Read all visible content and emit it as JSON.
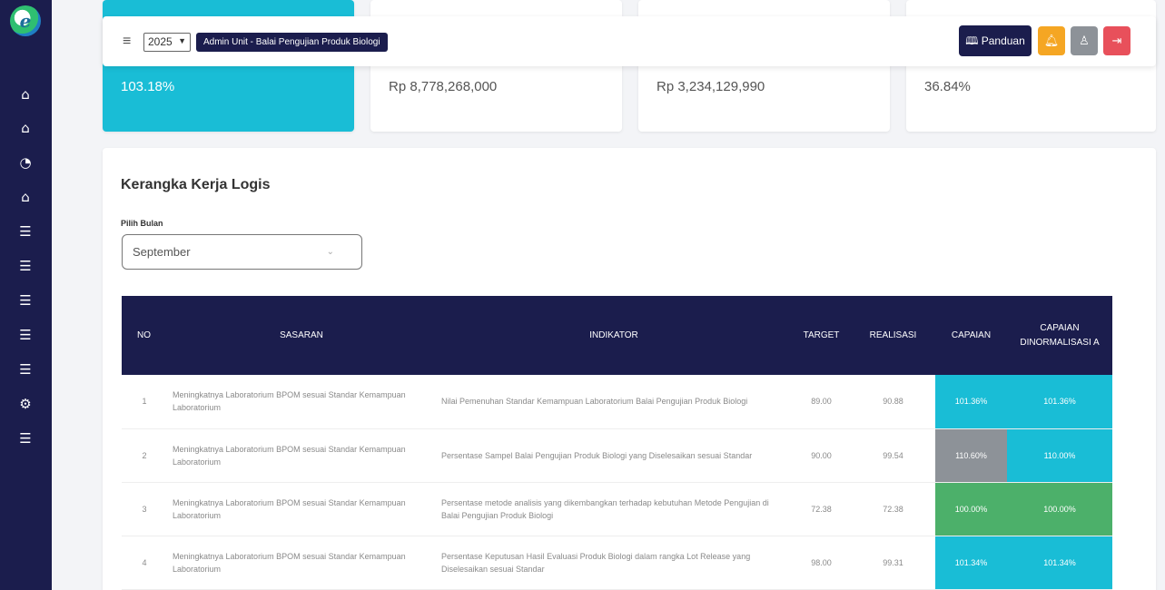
{
  "sidebar": {
    "logo_letter": "e",
    "items": [
      {
        "icon": "home-icon",
        "glyph": "⌂"
      },
      {
        "icon": "home-icon",
        "glyph": "⌂"
      },
      {
        "icon": "chart-pie-icon",
        "glyph": "◔"
      },
      {
        "icon": "home-icon",
        "glyph": "⌂"
      },
      {
        "icon": "database-icon",
        "glyph": "☰"
      },
      {
        "icon": "database-icon",
        "glyph": "☰"
      },
      {
        "icon": "database-icon",
        "glyph": "☰"
      },
      {
        "icon": "database-icon",
        "glyph": "☰"
      },
      {
        "icon": "database-icon",
        "glyph": "☰"
      },
      {
        "icon": "gear-icon",
        "glyph": "⚙"
      },
      {
        "icon": "database-icon",
        "glyph": "☰"
      }
    ]
  },
  "stats": [
    {
      "value": "103.18%"
    },
    {
      "value": "Rp 8,778,268,000"
    },
    {
      "value": "Rp 3,234,129,990"
    },
    {
      "value": "36.84%"
    }
  ],
  "header": {
    "year": "2025",
    "unit_badge": "Admin Unit - Balai Pengujian Produk Biologi",
    "panduan_label": "Panduan",
    "colors": {
      "navy": "#1b1d4d",
      "orange": "#f5a623",
      "gray": "#8d9298",
      "red": "#e8505b"
    }
  },
  "panel": {
    "title": "Kerangka Kerja Logis",
    "month_label": "Pilih Bulan",
    "month_value": "September"
  },
  "table": {
    "headers": {
      "no": "NO",
      "sasaran": "SASARAN",
      "indikator": "INDIKATOR",
      "target": "TARGET",
      "realisasi": "REALISASI",
      "capaian": "CAPAIAN",
      "capaian_norm": "CAPAIAN DINORMALISASI A"
    },
    "rows": [
      {
        "no": "1",
        "sasaran": "Meningkatnya Laboratorium BPOM sesuai Standar Kemampuan Laboratorium",
        "indikator": "Nilai Pemenuhan Standar Kemampuan Laboratorium Balai Pengujian Produk Biologi",
        "target": "89.00",
        "realisasi": "90.88",
        "capaian": "101.36%",
        "capaian_norm": "101.36%",
        "cap_color": "#19bdd6",
        "norm_color": "#19bdd6"
      },
      {
        "no": "2",
        "sasaran": "Meningkatnya Laboratorium BPOM sesuai Standar Kemampuan Laboratorium",
        "indikator": "Persentase Sampel Balai Pengujian Produk Biologi yang Diselesaikan sesuai Standar",
        "target": "90.00",
        "realisasi": "99.54",
        "capaian": "110.60%",
        "capaian_norm": "110.00%",
        "cap_color": "#8d9298",
        "norm_color": "#19bdd6"
      },
      {
        "no": "3",
        "sasaran": "Meningkatnya Laboratorium BPOM sesuai Standar Kemampuan Laboratorium",
        "indikator": "Persentase metode analisis yang dikembangkan terhadap kebutuhan Metode Pengujian di Balai Pengujian Produk Biologi",
        "target": "72.38",
        "realisasi": "72.38",
        "capaian": "100.00%",
        "capaian_norm": "100.00%",
        "cap_color": "#4cb06a",
        "norm_color": "#4cb06a"
      },
      {
        "no": "4",
        "sasaran": "Meningkatnya Laboratorium BPOM sesuai Standar Kemampuan Laboratorium",
        "indikator": "Persentase Keputusan Hasil Evaluasi Produk Biologi dalam rangka Lot Release yang Diselesaikan sesuai Standar",
        "target": "98.00",
        "realisasi": "99.31",
        "capaian": "101.34%",
        "capaian_norm": "101.34%",
        "cap_color": "#19bdd6",
        "norm_color": "#19bdd6"
      }
    ]
  }
}
